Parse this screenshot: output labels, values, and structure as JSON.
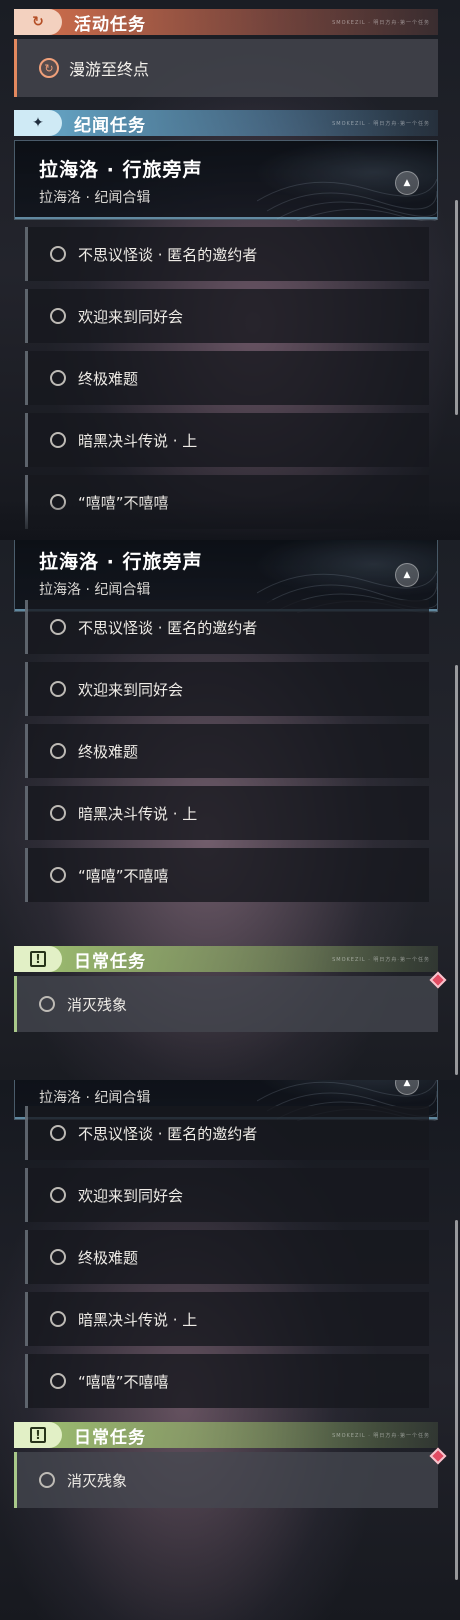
{
  "active_section": {
    "title": "活动任务",
    "tag": "SMOKEZIL · 明日方舟·第一个任务",
    "icon": "refresh-loop-icon"
  },
  "active_task": {
    "label": "漫游至终点",
    "icon": "refresh-loop-icon"
  },
  "memoir_section": {
    "title": "纪闻任务",
    "tag": "SMOKEZIL · 明日方舟·第一个任务",
    "icon": "sparkle-star-icon"
  },
  "series": {
    "title": "拉海洛 · 行旅旁声",
    "subtitle": "拉海洛 · 纪闻合辑",
    "toggle_icon": "triangle-up-icon"
  },
  "quests": [
    {
      "label": "不思议怪谈 · 匿名的邀约者"
    },
    {
      "label": "欢迎来到同好会"
    },
    {
      "label": "终极难题"
    },
    {
      "label": "暗黑决斗传说 · 上"
    },
    {
      "label": "“嘻嘻”不嘻嘻"
    }
  ],
  "daily_section": {
    "title": "日常任务",
    "tag": "SMOKEZIL · 明日方舟·第一个任务",
    "icon": "exclamation-box-icon"
  },
  "daily_task": {
    "label": "消灭残象",
    "badge_color": "#e24b62"
  },
  "colors": {
    "active_accent": "#e3895f",
    "memoir_accent": "#6eb4d7",
    "daily_accent": "#aacd78"
  }
}
